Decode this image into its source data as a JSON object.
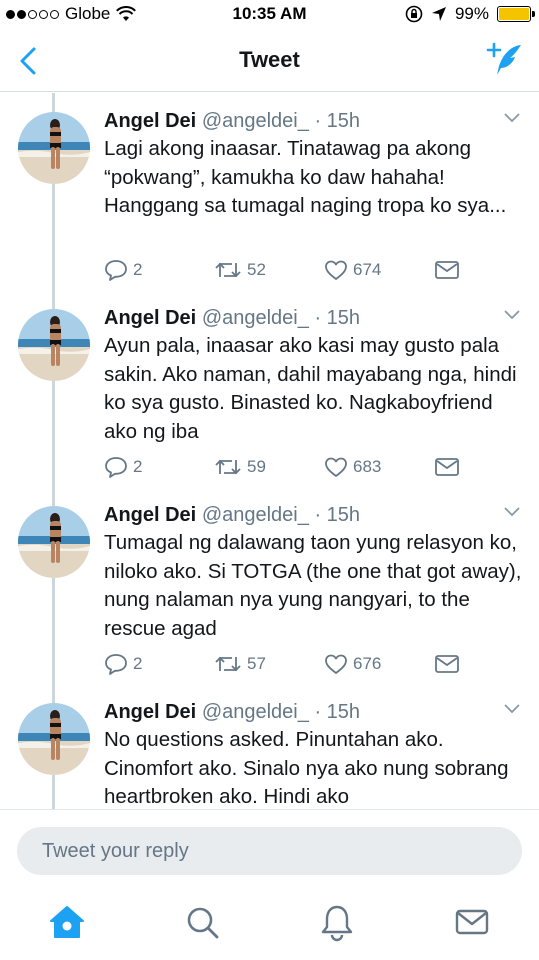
{
  "status_bar": {
    "carrier": "Globe",
    "time": "10:35 AM",
    "battery": "99%",
    "signal_bars_filled": 2,
    "signal_bars_total": 5
  },
  "nav": {
    "title": "Tweet",
    "back_icon": "chevron-left-icon",
    "compose_icon": "compose-tweet-icon"
  },
  "tweets": [
    {
      "name": "Angel Dei",
      "handle": "@angeldei_",
      "time": "· 15h",
      "text": "Lagi akong inaasar. Tinatawag pa akong “pokwang”, kamukha ko daw hahaha! Hanggang sa tumagal naging tropa ko sya...",
      "replies": "2",
      "retweets": "52",
      "likes": "674"
    },
    {
      "name": "Angel Dei",
      "handle": "@angeldei_",
      "time": "· 15h",
      "text": "Ayun pala, inaasar ako kasi may gusto pala sakin. Ako naman, dahil mayabang nga, hindi ko sya gusto. Binasted ko. Nagkaboyfriend ako ng iba",
      "replies": "2",
      "retweets": "59",
      "likes": "683"
    },
    {
      "name": "Angel Dei",
      "handle": "@angeldei_",
      "time": "· 15h",
      "text": "Tumagal ng dalawang taon yung relasyon ko, niloko ako. Si TOTGA (the one that got away), nung nalaman nya yung nangyari, to the rescue agad",
      "replies": "2",
      "retweets": "57",
      "likes": "676"
    },
    {
      "name": "Angel Dei",
      "handle": "@angeldei_",
      "time": "· 15h",
      "text": "No questions asked. Pinuntahan ako. Cinomfort ako. Sinalo nya ako nung sobrang heartbroken ako. Hindi ako",
      "replies": "",
      "retweets": "",
      "likes": ""
    }
  ],
  "reply": {
    "placeholder": "Tweet your reply"
  },
  "tab_bar": {
    "active": "home",
    "items": [
      "home-icon",
      "search-icon",
      "notifications-bell-icon",
      "messages-envelope-icon"
    ]
  },
  "colors": {
    "accent": "#1da1f2",
    "secondary_text": "#657786",
    "divider": "#ccd6dd",
    "battery_fill": "#f5c400"
  }
}
